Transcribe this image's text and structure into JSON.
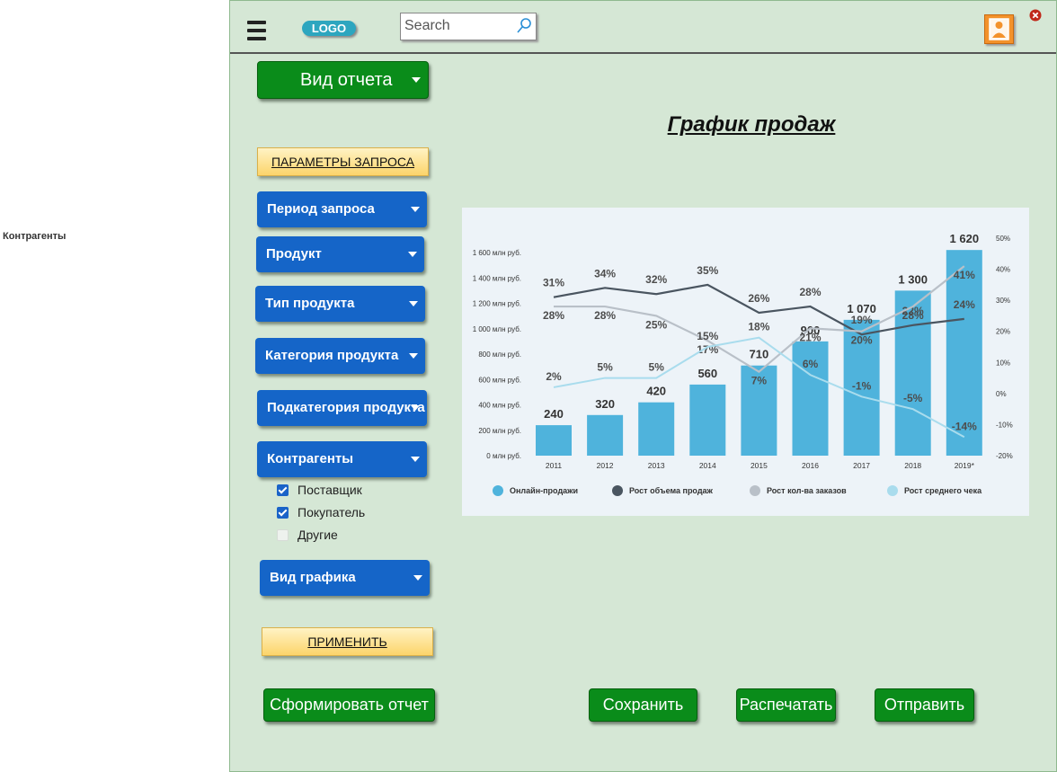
{
  "side_label": "Контрагенты",
  "header": {
    "logo": "LOGO",
    "search_placeholder": "Search"
  },
  "report_view_label": "Вид отчета",
  "params_button": "ПАРАМЕТРЫ ЗАПРОСА",
  "filters": [
    {
      "label": "Период запроса"
    },
    {
      "label": "Продукт"
    },
    {
      "label": "Тип продукта"
    },
    {
      "label": "Категория продукта"
    },
    {
      "label": "Подкатегория продукта"
    },
    {
      "label": "Контрагенты"
    }
  ],
  "counterparties": [
    {
      "label": "Поставщик",
      "checked": true
    },
    {
      "label": "Покупатель",
      "checked": true
    },
    {
      "label": "Другие",
      "checked": false
    }
  ],
  "chart_view_label": "Вид графика",
  "apply_button": "ПРИМЕНИТЬ",
  "footer": {
    "generate": "Сформировать отчет",
    "save": "Сохранить",
    "print": "Распечатать",
    "send": "Отправить"
  },
  "chart_title": "График продаж",
  "colors": {
    "bar": "#4fb3dc",
    "volume": "#4a5560",
    "orders": "#b9c0c8",
    "avg_check": "#a9dced",
    "green": "#0a8c1a",
    "blue": "#1565c8"
  },
  "chart_data": {
    "type": "bar",
    "categories": [
      "2011",
      "2012",
      "2013",
      "2014",
      "2015",
      "2016",
      "2017",
      "2018",
      "2019*"
    ],
    "y_left_ticks": [
      "0 млн руб.",
      "200 млн руб.",
      "400 млн руб.",
      "600 млн руб.",
      "800 млн руб.",
      "1 000 млн руб.",
      "1 200 млн руб.",
      "1 400 млн руб.",
      "1 600 млн руб."
    ],
    "y_right_ticks": [
      "-20%",
      "-10%",
      "0%",
      "10%",
      "20%",
      "30%",
      "40%",
      "50%"
    ],
    "ylim_left": [
      0,
      1600
    ],
    "ylim_right": [
      -20,
      50
    ],
    "grid": false,
    "legend_position": "bottom",
    "series": [
      {
        "name": "Онлайн-продажи",
        "kind": "bar",
        "axis": "left",
        "values": [
          240,
          320,
          420,
          560,
          710,
          900,
          1070,
          1300,
          1620
        ],
        "labels": [
          "240",
          "320",
          "420",
          "560",
          "710",
          "900",
          "1 070",
          "1 300",
          "1 620"
        ]
      },
      {
        "name": "Рост объема продаж",
        "kind": "line",
        "axis": "right",
        "values": [
          31,
          34,
          32,
          35,
          26,
          28,
          19,
          22,
          24
        ],
        "labels": [
          "31%",
          "34%",
          "32%",
          "35%",
          "26%",
          "28%",
          "19%",
          "22%",
          "24%"
        ]
      },
      {
        "name": "Рост кол-ва заказов",
        "kind": "line",
        "axis": "right",
        "values": [
          28,
          28,
          25,
          17,
          7,
          21,
          20,
          28,
          41
        ],
        "labels": [
          "28%",
          "28%",
          "25%",
          "17%",
          "7%",
          "21%",
          "20%",
          "28%",
          "41%"
        ]
      },
      {
        "name": "Рост среднего чека",
        "kind": "line",
        "axis": "right",
        "values": [
          2,
          5,
          5,
          15,
          18,
          6,
          -1,
          -5,
          -14
        ],
        "labels": [
          "2%",
          "5%",
          "5%",
          "15%",
          "18%",
          "6%",
          "-1%",
          "-5%",
          "-14%"
        ]
      }
    ]
  }
}
